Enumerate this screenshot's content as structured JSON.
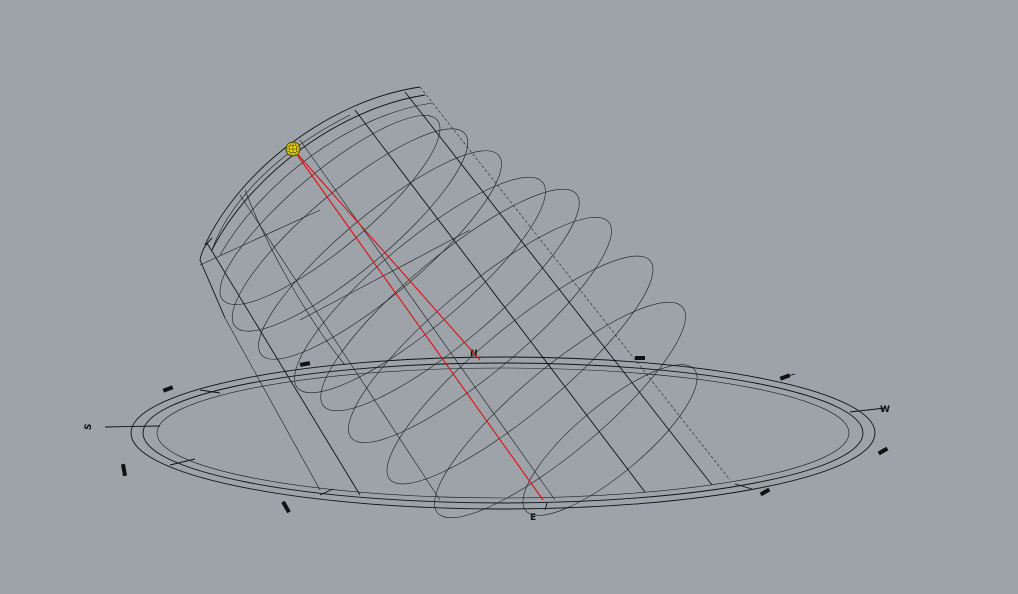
{
  "viewport": {
    "background": "#9ea3a9"
  },
  "sun": {
    "icon": "sun-sphere-icon",
    "fill": "#e8d21a"
  },
  "ray": {
    "color": "#e01010"
  },
  "compass_labels": [
    "S",
    "W",
    "N",
    "E"
  ]
}
